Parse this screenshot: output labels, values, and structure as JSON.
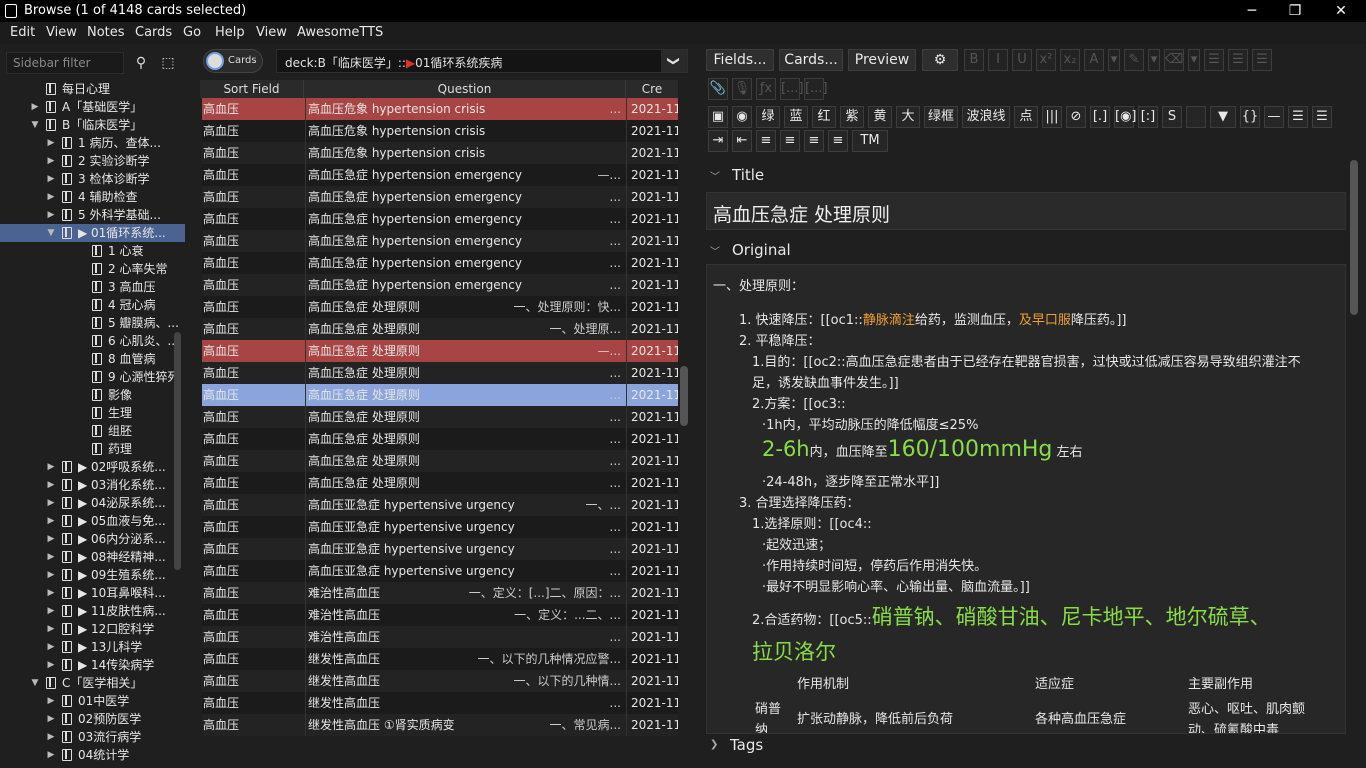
{
  "window": {
    "title": "Browse (1 of 4148 cards selected)",
    "minimize": "─",
    "maximize": "❐",
    "close": "✕"
  },
  "menu": [
    "Edit",
    "View",
    "Notes",
    "Cards",
    "Go",
    "Help",
    "View",
    "AwesomeTTS"
  ],
  "sidebar": {
    "filter_placeholder": "Sidebar filter",
    "search_icon": "⚲",
    "select_icon": "⬚",
    "items": [
      {
        "label": "每日心理",
        "arrow": "",
        "flag": false,
        "indent": 0
      },
      {
        "label": "A「基础医学」",
        "arrow": "▶",
        "flag": false,
        "indent": 0
      },
      {
        "label": "B「临床医学」",
        "arrow": "▼",
        "flag": false,
        "indent": 0
      },
      {
        "label": "1 病历、查体...",
        "arrow": "▶",
        "flag": false,
        "indent": 1
      },
      {
        "label": "2 实验诊断学",
        "arrow": "▶",
        "flag": false,
        "indent": 1
      },
      {
        "label": "3 检体诊断学",
        "arrow": "▶",
        "flag": false,
        "indent": 1
      },
      {
        "label": "4 辅助检查",
        "arrow": "▶",
        "flag": false,
        "indent": 1
      },
      {
        "label": "5 外科学基础...",
        "arrow": "▶",
        "flag": false,
        "indent": 1
      },
      {
        "label": "01循环系统...",
        "arrow": "▼",
        "flag": true,
        "indent": 1,
        "selected": true
      },
      {
        "label": "1 心衰",
        "arrow": "",
        "flag": false,
        "indent": 2
      },
      {
        "label": "2 心率失常",
        "arrow": "",
        "flag": false,
        "indent": 2
      },
      {
        "label": "3 高血压",
        "arrow": "",
        "flag": false,
        "indent": 2
      },
      {
        "label": "4 冠心病",
        "arrow": "",
        "flag": false,
        "indent": 2
      },
      {
        "label": "5 瓣膜病、...",
        "arrow": "",
        "flag": false,
        "indent": 2
      },
      {
        "label": "6 心肌炎、...",
        "arrow": "",
        "flag": false,
        "indent": 2
      },
      {
        "label": "8 血管病",
        "arrow": "",
        "flag": false,
        "indent": 2
      },
      {
        "label": "9 心源性猝死",
        "arrow": "",
        "flag": false,
        "indent": 2
      },
      {
        "label": "影像",
        "arrow": "",
        "flag": false,
        "indent": 2
      },
      {
        "label": "生理",
        "arrow": "",
        "flag": false,
        "indent": 2
      },
      {
        "label": "组胚",
        "arrow": "",
        "flag": false,
        "indent": 2
      },
      {
        "label": "药理",
        "arrow": "",
        "flag": false,
        "indent": 2
      },
      {
        "label": "02呼吸系统...",
        "arrow": "▶",
        "flag": true,
        "indent": 1
      },
      {
        "label": "03消化系统...",
        "arrow": "▶",
        "flag": true,
        "indent": 1
      },
      {
        "label": "04泌尿系统...",
        "arrow": "▶",
        "flag": true,
        "indent": 1
      },
      {
        "label": "05血液与免...",
        "arrow": "▶",
        "flag": true,
        "indent": 1
      },
      {
        "label": "06内分泌系...",
        "arrow": "▶",
        "flag": true,
        "indent": 1
      },
      {
        "label": "08神经精神...",
        "arrow": "▶",
        "flag": true,
        "indent": 1
      },
      {
        "label": "09生殖系统...",
        "arrow": "▶",
        "flag": true,
        "indent": 1
      },
      {
        "label": "10耳鼻喉科...",
        "arrow": "▶",
        "flag": true,
        "indent": 1
      },
      {
        "label": "11皮肤性病...",
        "arrow": "▶",
        "flag": true,
        "indent": 1
      },
      {
        "label": "12口腔科学",
        "arrow": "▶",
        "flag": true,
        "indent": 1
      },
      {
        "label": "13儿科学",
        "arrow": "▶",
        "flag": true,
        "indent": 1
      },
      {
        "label": "14传染病学",
        "arrow": "▶",
        "flag": true,
        "indent": 1
      },
      {
        "label": "C「医学相关」",
        "arrow": "▼",
        "flag": false,
        "indent": 0
      },
      {
        "label": "01中医学",
        "arrow": "▶",
        "flag": false,
        "indent": 1
      },
      {
        "label": "02预防医学",
        "arrow": "▶",
        "flag": false,
        "indent": 1
      },
      {
        "label": "03流行病学",
        "arrow": "▶",
        "flag": false,
        "indent": 1
      },
      {
        "label": "04统计学",
        "arrow": "▶",
        "flag": false,
        "indent": 1
      }
    ]
  },
  "cards_toggle": "Cards",
  "search": {
    "prefix": "deck:B「临床医学」::",
    "deck": "01循环系统疾病",
    "dropdown": "❯"
  },
  "table": {
    "headers": [
      "Sort Field",
      "Question",
      "Cre"
    ],
    "rows": [
      {
        "sort": "高血压",
        "q": "高血压危象 hypertension crisis",
        "a": "...",
        "c": "2021-11",
        "style": "red"
      },
      {
        "sort": "高血压",
        "q": "高血压危象 hypertension crisis",
        "a": "",
        "c": "2021-11",
        "style": "odd"
      },
      {
        "sort": "高血压",
        "q": "高血压危象 hypertension crisis",
        "a": "",
        "c": "2021-11",
        "style": "even"
      },
      {
        "sort": "高血压",
        "q": "高血压急症 hypertension emergency",
        "a": "—...",
        "c": "2021-11",
        "style": "odd"
      },
      {
        "sort": "高血压",
        "q": "高血压急症 hypertension emergency",
        "a": "...",
        "c": "2021-11",
        "style": "even"
      },
      {
        "sort": "高血压",
        "q": "高血压急症 hypertension emergency",
        "a": "...",
        "c": "2021-11",
        "style": "odd"
      },
      {
        "sort": "高血压",
        "q": "高血压急症 hypertension emergency",
        "a": "...",
        "c": "2021-11",
        "style": "even"
      },
      {
        "sort": "高血压",
        "q": "高血压急症 hypertension emergency",
        "a": "...",
        "c": "2021-11",
        "style": "odd"
      },
      {
        "sort": "高血压",
        "q": "高血压急症 hypertension emergency",
        "a": "...",
        "c": "2021-11",
        "style": "even"
      },
      {
        "sort": "高血压",
        "q": "高血压急症  处理原则",
        "a": "一、处理原则：快...",
        "c": "2021-11",
        "style": "odd"
      },
      {
        "sort": "高血压",
        "q": "高血压急症  处理原则",
        "a": "一、处理原...",
        "c": "2021-11",
        "style": "even"
      },
      {
        "sort": "高血压",
        "q": "高血压急症  处理原则",
        "a": "—...",
        "c": "2021-11",
        "style": "red"
      },
      {
        "sort": "高血压",
        "q": "高血压急症  处理原则",
        "a": "...",
        "c": "2021-11",
        "style": "even"
      },
      {
        "sort": "高血压",
        "q": "高血压急症  处理原则",
        "a": "...",
        "c": "2021-11",
        "style": "blue"
      },
      {
        "sort": "高血压",
        "q": "高血压急症  处理原则",
        "a": "...",
        "c": "2021-11",
        "style": "even"
      },
      {
        "sort": "高血压",
        "q": "高血压急症  处理原则",
        "a": "...",
        "c": "2021-11",
        "style": "odd"
      },
      {
        "sort": "高血压",
        "q": "高血压急症  处理原则",
        "a": "...",
        "c": "2021-11",
        "style": "even"
      },
      {
        "sort": "高血压",
        "q": "高血压急症  处理原则",
        "a": "...",
        "c": "2021-11",
        "style": "odd"
      },
      {
        "sort": "高血压",
        "q": "高血压亚急症 hypertensive urgency",
        "a": "一、...",
        "c": "2021-11",
        "style": "even"
      },
      {
        "sort": "高血压",
        "q": "高血压亚急症 hypertensive urgency",
        "a": "...",
        "c": "2021-11",
        "style": "odd"
      },
      {
        "sort": "高血压",
        "q": "高血压亚急症 hypertensive urgency",
        "a": "...",
        "c": "2021-11",
        "style": "even"
      },
      {
        "sort": "高血压",
        "q": "高血压亚急症 hypertensive urgency",
        "a": "...",
        "c": "2021-11",
        "style": "odd"
      },
      {
        "sort": "高血压",
        "q": "难治性高血压",
        "a": "一、定义：[...]二、原因：...",
        "c": "2021-11",
        "style": "even"
      },
      {
        "sort": "高血压",
        "q": "难治性高血压",
        "a": "一、定义：...二、...",
        "c": "2021-11",
        "style": "odd"
      },
      {
        "sort": "高血压",
        "q": "难治性高血压",
        "a": "...",
        "c": "2021-11",
        "style": "even"
      },
      {
        "sort": "高血压",
        "q": "继发性高血压",
        "a": "一、以下的几种情况应警...",
        "c": "2021-11",
        "style": "odd"
      },
      {
        "sort": "高血压",
        "q": "继发性高血压",
        "a": "一、以下的几种情...",
        "c": "2021-11",
        "style": "even"
      },
      {
        "sort": "高血压",
        "q": "继发性高血压",
        "a": "...",
        "c": "2021-11",
        "style": "odd"
      },
      {
        "sort": "高血压",
        "q": "继发性高血压 ①肾实质病变",
        "a": "一、常见病...",
        "c": "2021-11",
        "style": "even"
      }
    ]
  },
  "editor": {
    "buttons": {
      "fields": "Fields...",
      "cards": "Cards...",
      "preview": "Preview",
      "gear": "⚙"
    },
    "fmt_row1": [
      "B",
      "I",
      "U",
      "x²",
      "x₂",
      "A",
      "▾",
      "✎",
      "▾",
      "⌫",
      "▾",
      "☰",
      "☰",
      "☰"
    ],
    "attach_row": [
      "📎",
      "🎙",
      "ƒx",
      "[...]",
      "[...]"
    ],
    "tags_row": [
      "▣",
      "◉",
      "绿",
      "蓝",
      "红",
      "紫",
      "黄",
      "大",
      "绿框",
      "波浪线",
      "点",
      "|||",
      "⊘",
      "[.]",
      "[◉]",
      "[:]",
      "S",
      "",
      "▼",
      "{}",
      "—",
      "☰",
      "☰"
    ],
    "align_row": [
      "⇥",
      "⇤",
      "≡",
      "≡",
      "≡",
      "≡",
      "TM"
    ],
    "title_label": "Title",
    "title_value": "高血压急症  处理原则",
    "original_label": "Original",
    "tags_label": "Tags",
    "content": {
      "l0": "一、处理原则：",
      "l1a": "1. 快速降压：[[oc1::",
      "l1b": "静脉滴注",
      "l1c": "给药，监测血压，",
      "l1d": "及早口服",
      "l1e": "降压药。]]",
      "l2": "2. 平稳降压：",
      "l3": "1.目的：[[oc2::高血压急症患者由于已经存在靶器官损害，过快或过低减压容易导致组织灌注不",
      "l4": "足，诱发缺血事件发生。]]",
      "l5": "2.方案：[[oc3::",
      "l6": "·1h内，平均动脉压的降低幅度≤25%",
      "l7a": "2-6h",
      "l7b": "内，血压降至",
      "l7c": "160/100mmHg",
      "l7d": "左右",
      "l8": "·24-48h，逐步降至正常水平]]",
      "l9": "3. 合理选择降压药：",
      "l10": "1.选择原则：[[oc4::",
      "l11": "·起效迅速；",
      "l12": "·作用持续时间短，停药后作用消失快。",
      "l13": "·最好不明显影响心率、心输出量、脑血流量。]]",
      "l14a": "2.合适药物：[[oc5::",
      "l14b": "硝普钠、硝酸甘油、尼卡地平、地尔硫草、",
      "l15": "拉贝洛尔",
      "th1": "作用机制",
      "th2": "适应症",
      "th3": "主要副作用",
      "td0": "硝普",
      "td0b": "纳",
      "td1": "扩张动静脉，降低前后负荷",
      "td2": "各种高血压急症",
      "td3": "恶心、呕吐、肌肉颤",
      "td3b": "动、硫氰酸中毒"
    }
  },
  "colors": {
    "accent": "#8ba4dc",
    "selected_red": "#a84444",
    "green_text": "#88dd44",
    "orange_text": "#f0a030"
  }
}
